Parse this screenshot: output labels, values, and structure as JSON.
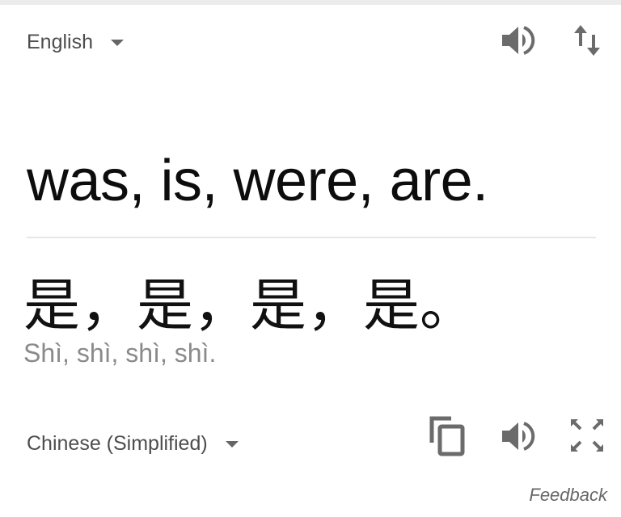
{
  "source": {
    "language": "English",
    "text": "was, is, were, are."
  },
  "target": {
    "language": "Chinese (Simplified)",
    "text": "是，是，是，是。",
    "romanization": "Shì, shì, shì, shì."
  },
  "actions": {
    "feedback_label": "Feedback"
  },
  "icons": {
    "source_speaker": "speaker-icon",
    "swap": "swap-languages-icon",
    "copy": "copy-icon",
    "target_speaker": "speaker-icon",
    "fullscreen": "fullscreen-icon"
  },
  "colors": {
    "icon": "#6b6b6b",
    "source_text": "#0d0d0d",
    "romanization": "#8a8a8a"
  }
}
